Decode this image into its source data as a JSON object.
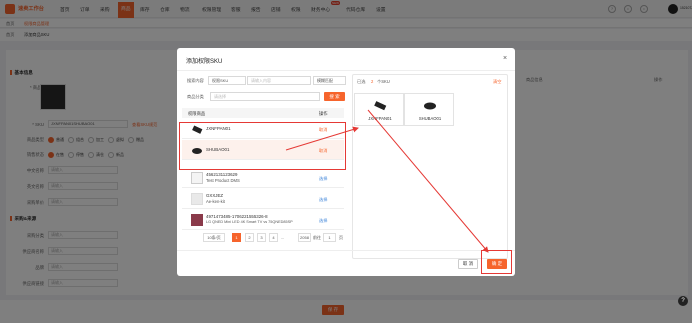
{
  "app": {
    "brand": "速卖工作台",
    "nav": [
      "首页",
      "订单",
      "采购",
      "商品",
      "库存",
      "仓库",
      "物流",
      "权限管理",
      "客服",
      "报告",
      "店铺",
      "权限",
      "财务中心",
      "代码仓库",
      "设置"
    ],
    "active_nav_index": 3,
    "hot_badge": "NEW",
    "username": "15210723448",
    "accent": "#f6642c"
  },
  "tabs": {
    "t1": "首页",
    "t2": "权限商品管理"
  },
  "breadcrumb": {
    "a": "首页",
    "b": "添加商品SKU"
  },
  "form": {
    "section1": "基本信息",
    "image_label": "* 商品图片",
    "sku_label": "* SKU",
    "sku_value": "JXNFPAN01SHUBAO01",
    "sku_link": "查看SKU规范",
    "type_label": "商品类型",
    "type_options": [
      "普通",
      "组合",
      "加工",
      "虚拟",
      "赠品"
    ],
    "status_label": "销售状态",
    "status_options": [
      "在售",
      "停售",
      "清仓",
      "新品"
    ],
    "field4": "中文名称",
    "field5": "英文名称",
    "field6": "采购单价",
    "section2": "采购&来源",
    "field7": "采购分类",
    "field8": "供应商名称",
    "field9": "品牌",
    "field10": "供应商链接",
    "placeholder": "请输入",
    "col_name": "商品信息",
    "col_op": "操作"
  },
  "bottom": {
    "save": "保 存"
  },
  "help": "?",
  "dialog": {
    "title": "添加权限SKU",
    "close": "×",
    "search_label": "搜索内容",
    "search_select": "权限SKU",
    "search_placeholder": "请输入内容",
    "fuzzy": "模糊匹配",
    "category_label": "商品分类",
    "category_placeholder": "请选择",
    "search_btn": "搜 索",
    "col_product": "权限商品",
    "col_op": "操作",
    "rows": [
      {
        "name": "JXNFPAN01",
        "sub": "",
        "action": "取消",
        "selected": true
      },
      {
        "name": "SHUBAO01",
        "sub": "",
        "action": "取消",
        "selected": true
      },
      {
        "name": "4562131123629",
        "sub": "Test Product DMS",
        "action": "选择",
        "selected": false
      },
      {
        "name": "GXXJEZ",
        "sub": "Ae-ken-kit",
        "action": "选择",
        "selected": false
      },
      {
        "name": "4971473485-1706221555326-8",
        "sub": "LG QNED Mini LED 4K Smart TV vs 75QNED85SP",
        "action": "选择",
        "selected": false
      }
    ],
    "page_size": "10条/页",
    "pages": [
      "1",
      "2",
      "3",
      "4",
      "...",
      "2058"
    ],
    "current_page": "1",
    "goto_label": "前往",
    "goto_value": "1",
    "page_suffix": "页",
    "selected_prefix": "已选",
    "selected_count": "2",
    "selected_suffix": "个SKU",
    "clear": "清空",
    "selected_items": [
      "JXNFPAN01",
      "SHUBAO01"
    ],
    "cancel": "取 消",
    "confirm": "确 定"
  }
}
